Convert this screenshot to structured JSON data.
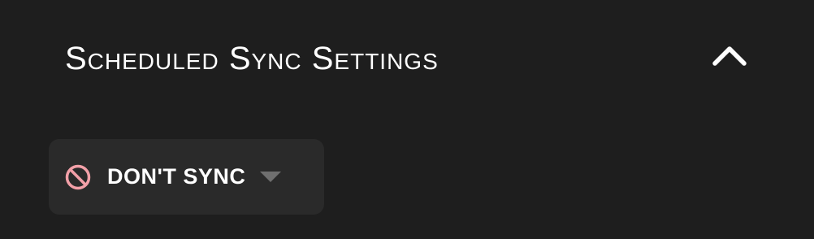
{
  "section": {
    "title": "Scheduled Sync Settings",
    "collapse_icon": "chevron-up-icon"
  },
  "sync_select": {
    "selected_value": "DON'T SYNC",
    "status_icon": "ban-icon",
    "dropdown_icon": "caret-down-icon"
  },
  "colors": {
    "background": "#1e1e1e",
    "select_background": "#2a2a2a",
    "text": "#ffffff",
    "ban_icon": "#f2a0a8",
    "caret": "#6f6f6f"
  }
}
